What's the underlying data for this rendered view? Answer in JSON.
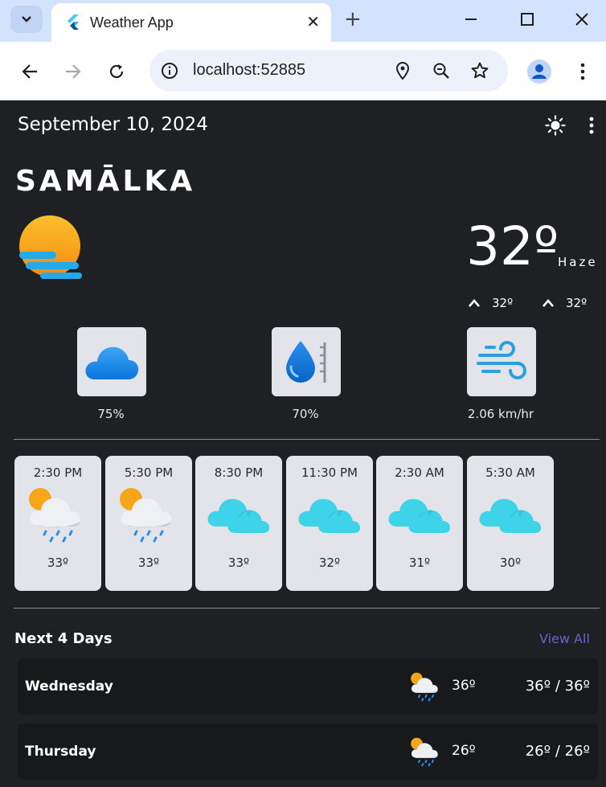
{
  "browser": {
    "tab_title": "Weather App",
    "url": "localhost:52885"
  },
  "app": {
    "date": "September 10, 2024",
    "city": "SAMĀLKA",
    "temperature": "32º",
    "condition": "Haze",
    "high": "32º",
    "low": "32º",
    "stats": {
      "clouds": "75%",
      "humidity": "70%",
      "wind": "2.06 km/hr"
    },
    "hourly": [
      {
        "time": "2:30 PM",
        "temp": "33º",
        "icon": "sun-cloud-rain-icon"
      },
      {
        "time": "5:30 PM",
        "temp": "33º",
        "icon": "sun-cloud-rain-icon"
      },
      {
        "time": "8:30 PM",
        "temp": "33º",
        "icon": "cloud-icon"
      },
      {
        "time": "11:30 PM",
        "temp": "32º",
        "icon": "cloud-icon"
      },
      {
        "time": "2:30 AM",
        "temp": "31º",
        "icon": "cloud-icon"
      },
      {
        "time": "5:30 AM",
        "temp": "30º",
        "icon": "cloud-icon"
      }
    ],
    "forecast_title": "Next 4 Days",
    "view_all": "View All",
    "days": [
      {
        "day": "Wednesday",
        "temp": "36º",
        "range": "36º / 36º",
        "icon": "sun-cloud-rain-icon"
      },
      {
        "day": "Thursday",
        "temp": "26º",
        "range": "26º / 26º",
        "icon": "sun-cloud-rain-icon"
      }
    ]
  },
  "colors": {
    "background": "#1f2023",
    "card": "#e2e4ea",
    "accent": "#6f5ec8",
    "cloud_cyan": "#3fd3ea",
    "browser_tabbar": "#d3e3fd"
  }
}
